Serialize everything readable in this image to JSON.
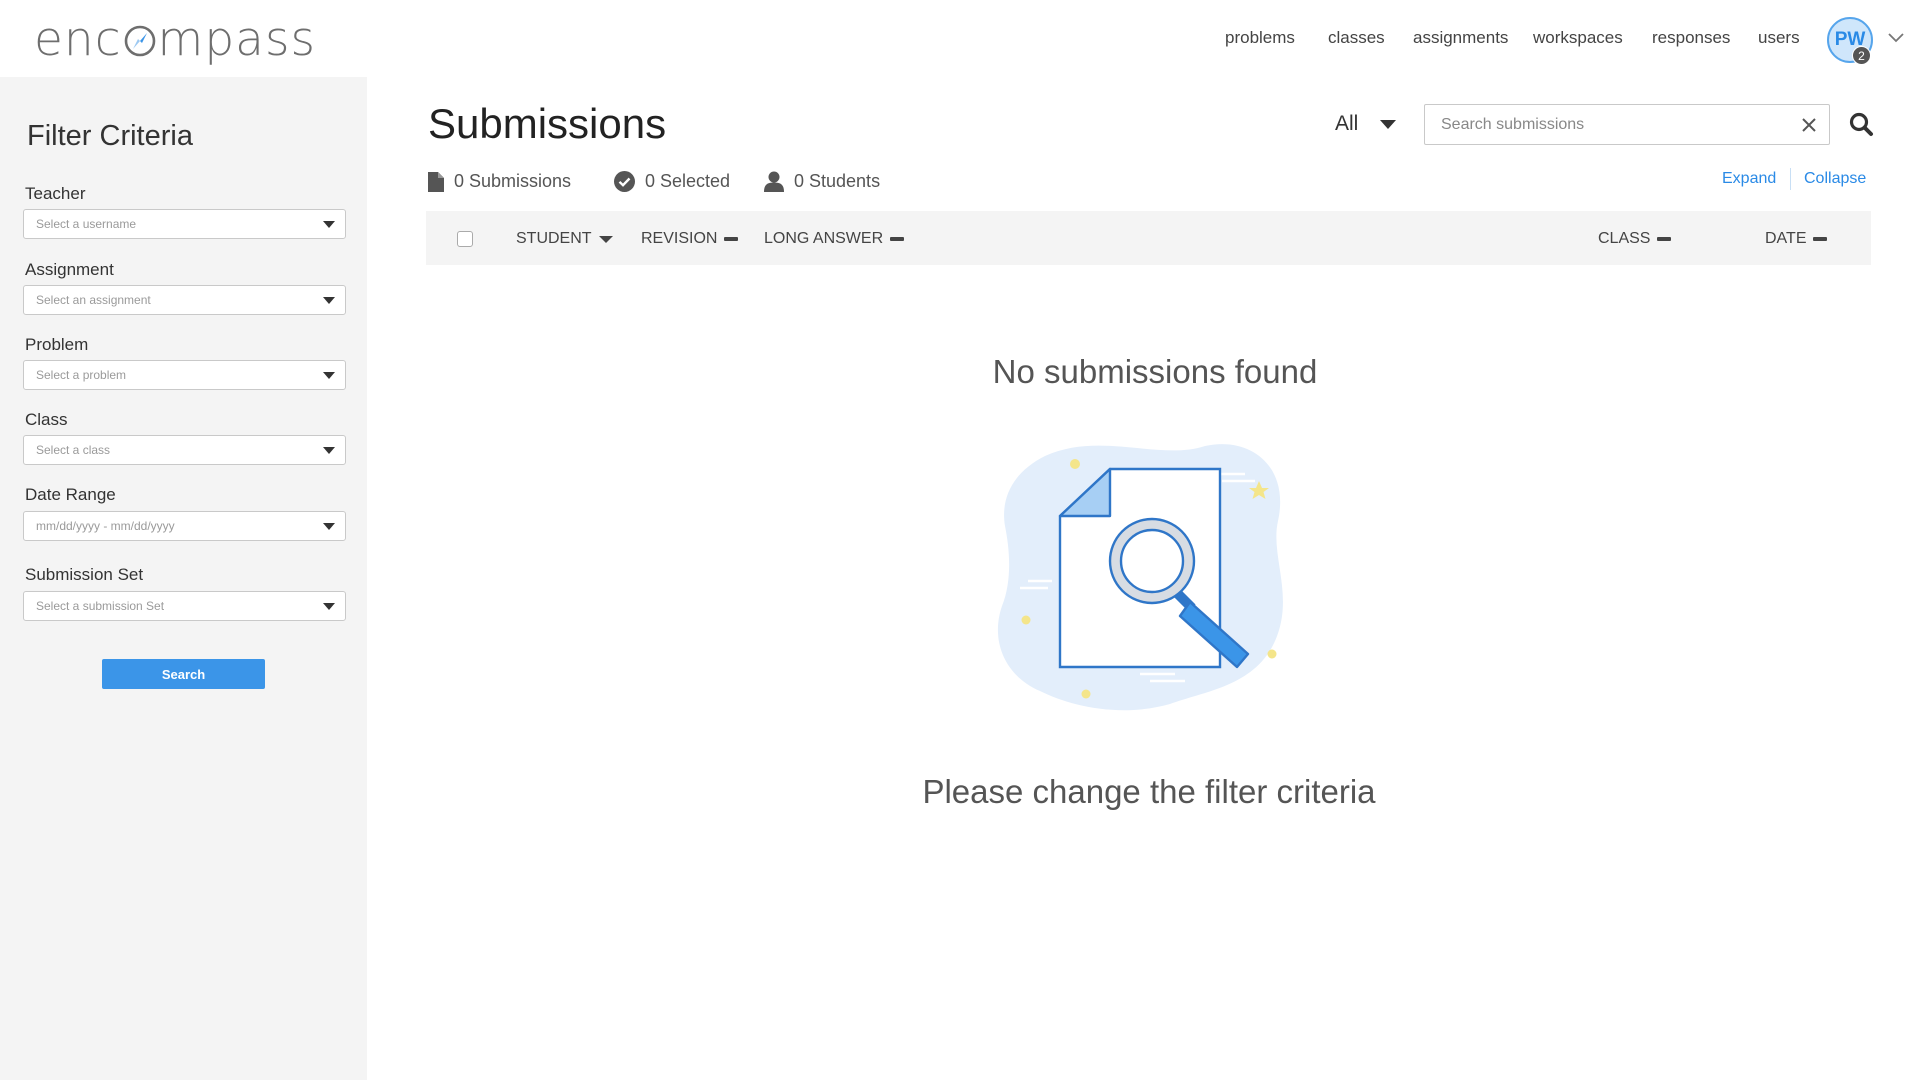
{
  "app": {
    "logo_text_start": "enc",
    "logo_text_end": "mpass"
  },
  "nav": {
    "items": [
      {
        "label": "problems"
      },
      {
        "label": "classes"
      },
      {
        "label": "assignments"
      },
      {
        "label": "workspaces"
      },
      {
        "label": "responses"
      },
      {
        "label": "users"
      }
    ],
    "avatar_initials": "PW",
    "avatar_badge": "2"
  },
  "sidebar": {
    "title": "Filter Criteria",
    "fields": [
      {
        "label": "Teacher",
        "placeholder": "Select a username"
      },
      {
        "label": "Assignment",
        "placeholder": "Select an assignment"
      },
      {
        "label": "Problem",
        "placeholder": "Select a problem"
      },
      {
        "label": "Class",
        "placeholder": "Select a class"
      },
      {
        "label": "Date Range",
        "placeholder": "mm/dd/yyyy - mm/dd/yyyy"
      },
      {
        "label": "Submission Set",
        "placeholder": "Select a submission Set"
      }
    ],
    "search_label": "Search"
  },
  "main": {
    "title": "Submissions",
    "filter_value": "All",
    "search_placeholder": "Search submissions",
    "stats": {
      "submissions": "0 Submissions",
      "selected": "0 Selected",
      "students": "0 Students"
    },
    "expand_label": "Expand",
    "collapse_label": "Collapse",
    "columns": [
      "STUDENT",
      "REVISION",
      "LONG ANSWER",
      "CLASS",
      "DATE"
    ],
    "empty_title": "No submissions found",
    "empty_hint": "Please change the filter criteria"
  },
  "colors": {
    "accent": "#3b95e8",
    "link": "#2a8ae6",
    "sidebar_bg": "#f4f4f4"
  }
}
